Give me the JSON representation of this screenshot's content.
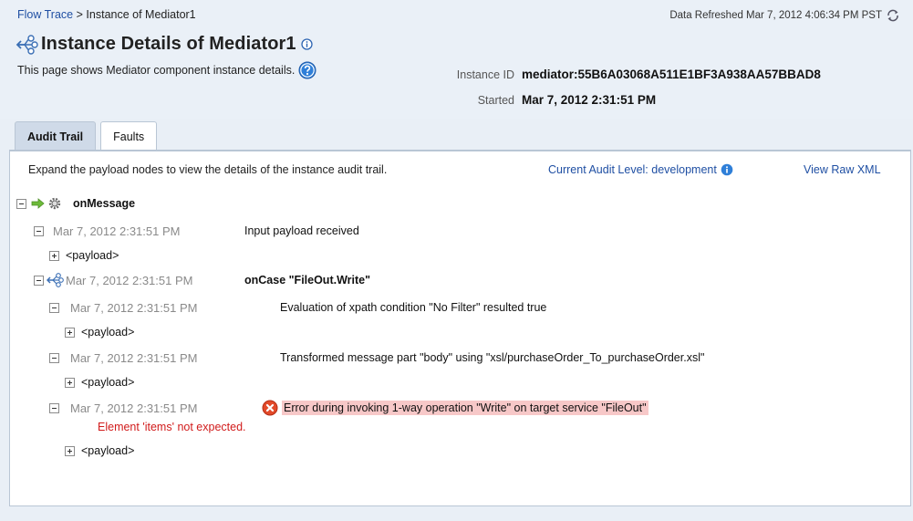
{
  "breadcrumb": {
    "link": "Flow Trace",
    "separator": ">",
    "current": "Instance of Mediator1"
  },
  "refresh": {
    "text": "Data Refreshed Mar 7, 2012 4:06:34 PM PST",
    "icon": "refresh-icon"
  },
  "header": {
    "title": "Instance Details of Mediator1",
    "title_icon": "mediator-icon",
    "description": "This page shows Mediator component instance details.",
    "help_icon": "help-icon"
  },
  "meta": {
    "instance_id_label": "Instance ID",
    "instance_id_value": "mediator:55B6A03068A511E1BF3A938AA57BBAD8",
    "started_label": "Started",
    "started_value": "Mar 7, 2012 2:31:51 PM"
  },
  "tabs": [
    {
      "label": "Audit Trail",
      "active": true
    },
    {
      "label": "Faults",
      "active": false
    }
  ],
  "toolbar": {
    "instructions": "Expand the payload nodes to view the details of the instance audit trail.",
    "audit_level": "Current Audit Level: development",
    "raw_xml": "View Raw XML"
  },
  "tree": {
    "root": {
      "label": "onMessage"
    },
    "items": [
      {
        "timestamp": "Mar 7, 2012 2:31:51 PM",
        "message": "Input payload received",
        "payload": "<payload>"
      },
      {
        "timestamp": "Mar 7, 2012 2:31:51 PM",
        "message": "onCase \"FileOut.Write\""
      },
      {
        "timestamp": "Mar 7, 2012 2:31:51 PM",
        "message": "Evaluation of xpath condition \"No Filter\" resulted true",
        "payload": "<payload>"
      },
      {
        "timestamp": "Mar 7, 2012 2:31:51 PM",
        "message": "Transformed message part \"body\" using \"xsl/purchaseOrder_To_purchaseOrder.xsl\"",
        "payload": "<payload>"
      },
      {
        "timestamp": "Mar 7, 2012 2:31:51 PM",
        "message": "Error during invoking 1-way operation \"Write\" on target service \"FileOut\"",
        "error_detail": "Element 'items' not expected.",
        "payload": "<payload>"
      }
    ]
  },
  "colors": {
    "link": "#1f4fa3",
    "error_text": "#d11b1b",
    "error_highlight": "#f7c8c8",
    "tab_active": "#cfdae8",
    "page_bg": "#e9eff6"
  }
}
